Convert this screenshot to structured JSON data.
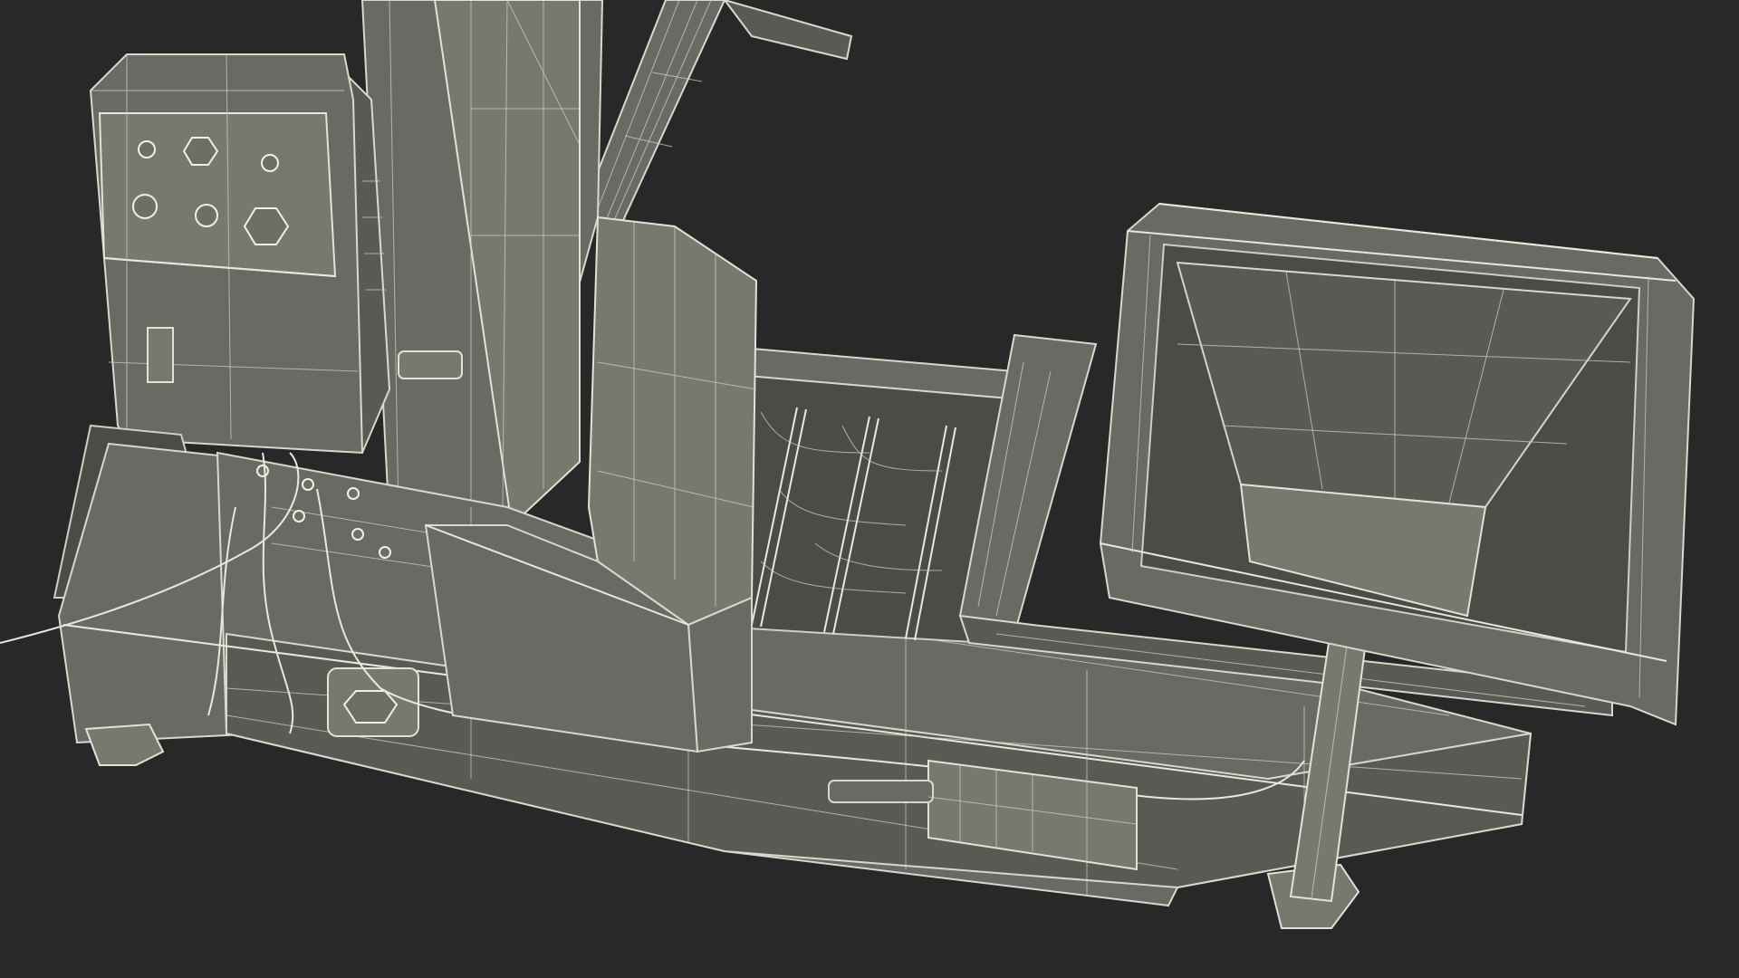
{
  "scene": {
    "background_color": "#282828",
    "model_fill_color": "#6a6a64",
    "wire_color": "#d8d8cc",
    "subject": "industrial-conveyor-machine-wireframe"
  }
}
